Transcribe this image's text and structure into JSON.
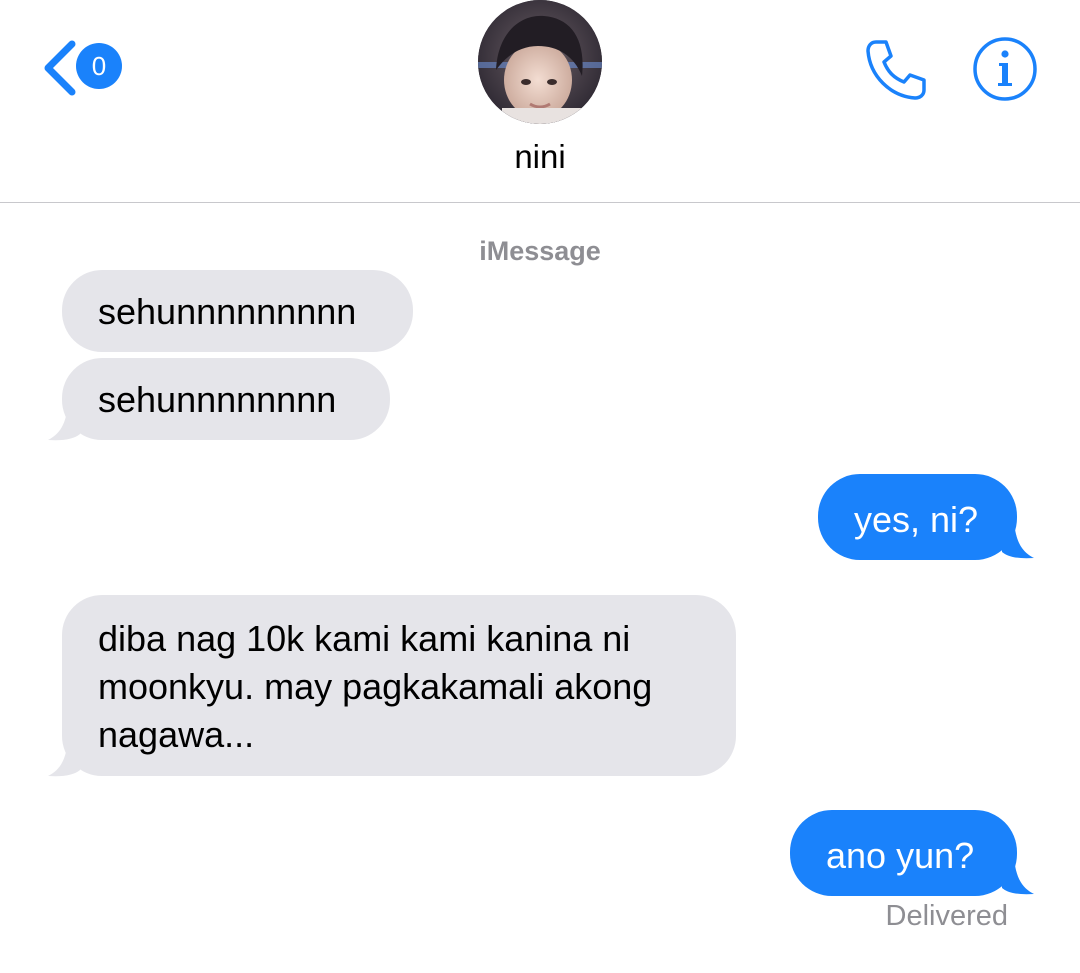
{
  "header": {
    "back_badge_count": "0",
    "contact_name": "nini",
    "service_label": "iMessage"
  },
  "colors": {
    "accent": "#1a82fb",
    "incoming_bubble": "#e5e5ea",
    "secondary_text": "#8e8e93"
  },
  "icons": {
    "back": "chevron-left-icon",
    "call": "phone-icon",
    "details": "info-icon"
  },
  "messages": [
    {
      "direction": "incoming",
      "text": "sehunnnnnnnnn"
    },
    {
      "direction": "incoming",
      "text": "sehunnnnnnnn"
    },
    {
      "direction": "outgoing",
      "text": "yes, ni?"
    },
    {
      "direction": "incoming",
      "text": "diba nag 10k kami kami kanina ni moonkyu. may pagkakamali akong nagawa..."
    },
    {
      "direction": "outgoing",
      "text": "ano yun?"
    }
  ],
  "status": {
    "last_message": "Delivered"
  }
}
